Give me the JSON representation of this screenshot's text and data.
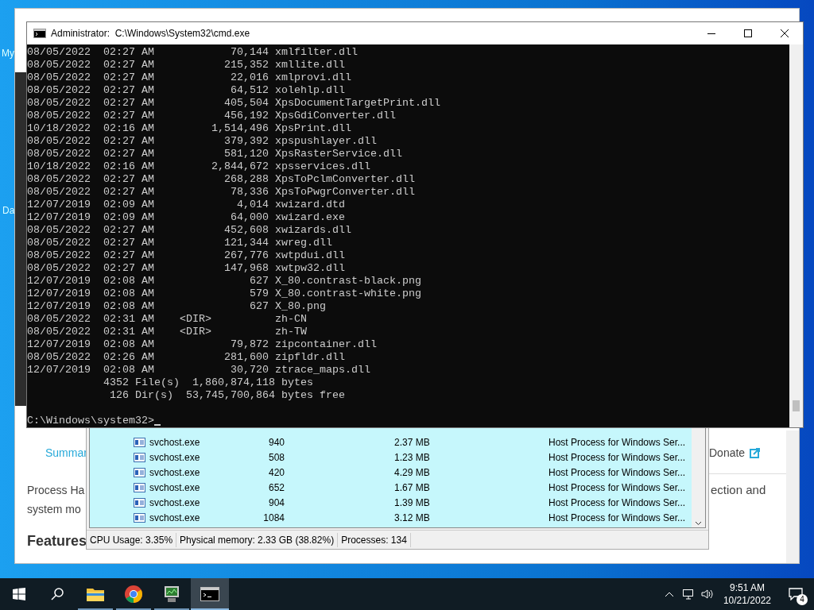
{
  "desktop_labels": [
    "My",
    "Da"
  ],
  "browser": {
    "nav_left": "Summar",
    "nav_right": "Donate",
    "paragraph_left": [
      "Process Ha",
      "system mo"
    ],
    "paragraph_right": "ection and",
    "heading": "Features"
  },
  "process_hacker": {
    "rows": [
      {
        "name": "svchost.exe",
        "pid": "940",
        "memory": "2.37 MB",
        "description": "Host Process for Windows Ser..."
      },
      {
        "name": "svchost.exe",
        "pid": "508",
        "memory": "1.23 MB",
        "description": "Host Process for Windows Ser..."
      },
      {
        "name": "svchost.exe",
        "pid": "420",
        "memory": "4.29 MB",
        "description": "Host Process for Windows Ser..."
      },
      {
        "name": "svchost.exe",
        "pid": "652",
        "memory": "1.67 MB",
        "description": "Host Process for Windows Ser..."
      },
      {
        "name": "svchost.exe",
        "pid": "904",
        "memory": "1.39 MB",
        "description": "Host Process for Windows Ser..."
      },
      {
        "name": "svchost.exe",
        "pid": "1084",
        "memory": "3.12 MB",
        "description": "Host Process for Windows Ser..."
      }
    ],
    "status_bar": [
      "CPU Usage: 3.35%",
      "Physical memory: 2.33 GB (38.82%)",
      "Processes: 134"
    ]
  },
  "cmd": {
    "title": "Administrator:  C:\\Windows\\System32\\cmd.exe",
    "listing": [
      {
        "date": "08/05/2022",
        "time": "02:27 AM",
        "kind": "file",
        "size": "70,144",
        "name": "xmlfilter.dll"
      },
      {
        "date": "08/05/2022",
        "time": "02:27 AM",
        "kind": "file",
        "size": "215,352",
        "name": "xmllite.dll"
      },
      {
        "date": "08/05/2022",
        "time": "02:27 AM",
        "kind": "file",
        "size": "22,016",
        "name": "xmlprovi.dll"
      },
      {
        "date": "08/05/2022",
        "time": "02:27 AM",
        "kind": "file",
        "size": "64,512",
        "name": "xolehlp.dll"
      },
      {
        "date": "08/05/2022",
        "time": "02:27 AM",
        "kind": "file",
        "size": "405,504",
        "name": "XpsDocumentTargetPrint.dll"
      },
      {
        "date": "08/05/2022",
        "time": "02:27 AM",
        "kind": "file",
        "size": "456,192",
        "name": "XpsGdiConverter.dll"
      },
      {
        "date": "10/18/2022",
        "time": "02:16 AM",
        "kind": "file",
        "size": "1,514,496",
        "name": "XpsPrint.dll"
      },
      {
        "date": "08/05/2022",
        "time": "02:27 AM",
        "kind": "file",
        "size": "379,392",
        "name": "xpspushlayer.dll"
      },
      {
        "date": "08/05/2022",
        "time": "02:27 AM",
        "kind": "file",
        "size": "581,120",
        "name": "XpsRasterService.dll"
      },
      {
        "date": "10/18/2022",
        "time": "02:16 AM",
        "kind": "file",
        "size": "2,844,672",
        "name": "xpsservices.dll"
      },
      {
        "date": "08/05/2022",
        "time": "02:27 AM",
        "kind": "file",
        "size": "268,288",
        "name": "XpsToPclmConverter.dll"
      },
      {
        "date": "08/05/2022",
        "time": "02:27 AM",
        "kind": "file",
        "size": "78,336",
        "name": "XpsToPwgrConverter.dll"
      },
      {
        "date": "12/07/2019",
        "time": "02:09 AM",
        "kind": "file",
        "size": "4,014",
        "name": "xwizard.dtd"
      },
      {
        "date": "12/07/2019",
        "time": "02:09 AM",
        "kind": "file",
        "size": "64,000",
        "name": "xwizard.exe"
      },
      {
        "date": "08/05/2022",
        "time": "02:27 AM",
        "kind": "file",
        "size": "452,608",
        "name": "xwizards.dll"
      },
      {
        "date": "08/05/2022",
        "time": "02:27 AM",
        "kind": "file",
        "size": "121,344",
        "name": "xwreg.dll"
      },
      {
        "date": "08/05/2022",
        "time": "02:27 AM",
        "kind": "file",
        "size": "267,776",
        "name": "xwtpdui.dll"
      },
      {
        "date": "08/05/2022",
        "time": "02:27 AM",
        "kind": "file",
        "size": "147,968",
        "name": "xwtpw32.dll"
      },
      {
        "date": "12/07/2019",
        "time": "02:08 AM",
        "kind": "file",
        "size": "627",
        "name": "X_80.contrast-black.png"
      },
      {
        "date": "12/07/2019",
        "time": "02:08 AM",
        "kind": "file",
        "size": "579",
        "name": "X_80.contrast-white.png"
      },
      {
        "date": "12/07/2019",
        "time": "02:08 AM",
        "kind": "file",
        "size": "627",
        "name": "X_80.png"
      },
      {
        "date": "08/05/2022",
        "time": "02:31 AM",
        "kind": "dir",
        "size": "<DIR>",
        "name": "zh-CN"
      },
      {
        "date": "08/05/2022",
        "time": "02:31 AM",
        "kind": "dir",
        "size": "<DIR>",
        "name": "zh-TW"
      },
      {
        "date": "12/07/2019",
        "time": "02:08 AM",
        "kind": "file",
        "size": "79,872",
        "name": "zipcontainer.dll"
      },
      {
        "date": "08/05/2022",
        "time": "02:26 AM",
        "kind": "file",
        "size": "281,600",
        "name": "zipfldr.dll"
      },
      {
        "date": "12/07/2019",
        "time": "02:08 AM",
        "kind": "file",
        "size": "30,720",
        "name": "ztrace_maps.dll"
      }
    ],
    "summary": [
      {
        "count": "4352",
        "label": "File(s)",
        "amount": "1,860,874,118",
        "suffix": "bytes"
      },
      {
        "count": "126",
        "label": "Dir(s)",
        "amount": "53,745,700,864",
        "suffix": "bytes free"
      }
    ],
    "prompt": "C:\\Windows\\system32>"
  },
  "taskbar": {
    "apps": [
      {
        "kind": "folder",
        "selected": false
      },
      {
        "kind": "chrome",
        "selected": false
      },
      {
        "kind": "monitor",
        "selected": false
      },
      {
        "kind": "console",
        "selected": true
      }
    ],
    "time": "9:51 AM",
    "date": "10/21/2022",
    "notifications": "4"
  }
}
